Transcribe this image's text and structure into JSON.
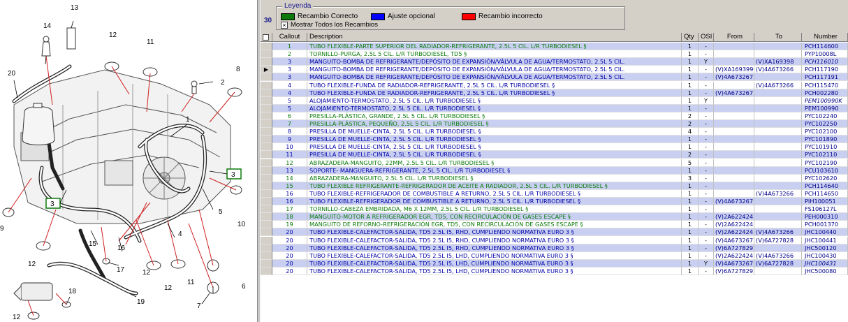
{
  "legend": {
    "title": "Leyenda",
    "items": [
      {
        "label": "Recambio Correcto",
        "color": "#0b7a0b"
      },
      {
        "label": "Ajuste opcional",
        "color": "#0000ff"
      },
      {
        "label": "Recambio incorrecto",
        "color": "#ff0000"
      }
    ],
    "show_all_label": "Mostrar Todos los Recambios",
    "show_all_checked": true,
    "record_count": "30"
  },
  "columns": [
    "Callout",
    "Description",
    "Qty",
    "OSI",
    "From",
    "To",
    "Number"
  ],
  "rows": [
    {
      "callout": "1",
      "desc": "TUBO FLEXIBLE-PARTE SUPERIOR DEL RADIADOR-REFRIGERANTE, 2.5L 5 CIL. L/R TURBODIESEL §",
      "qty": "1",
      "osi": "-",
      "from": "",
      "to": "",
      "number": "PCH114600",
      "color": "green",
      "hl": true
    },
    {
      "callout": "2",
      "desc": "TORNILLO-PURGA, 2.5L 5 CIL. L/R TURBODIESEL, TD5 §",
      "qty": "1",
      "osi": "-",
      "from": "",
      "to": "",
      "number": "PYP10008L",
      "color": "green",
      "hl": false
    },
    {
      "callout": "3",
      "desc": "MANGUITO-BOMBA DE REFRIGERANTE/DEPÓSITO DE EXPANSIÓN/VÁLVULA DE AGUA/TERMOSTATO, 2.5L 5 CIL.",
      "qty": "1",
      "osi": "Y",
      "from": "",
      "to": "(V)XA169398",
      "number": "PCH116010",
      "color": "blue",
      "hl": true,
      "italic_num": true
    },
    {
      "callout": "3",
      "desc": "MANGUITO-BOMBA DE REFRIGERANTE/DEPÓSITO DE EXPANSIÓN/VÁLVULA DE AGUA/TERMOSTATO, 2.5L 5 CIL.",
      "qty": "1",
      "osi": "-",
      "from": "(V)XA169399",
      "to": "(V)4A673266",
      "number": "PCH117190",
      "color": "blue",
      "hl": false,
      "current": true
    },
    {
      "callout": "3",
      "desc": "MANGUITO-BOMBA DE REFRIGERANTE/DEPÓSITO DE EXPANSIÓN/VÁLVULA DE AGUA/TERMOSTATO, 2.5L 5 CIL.",
      "qty": "1",
      "osi": "-",
      "from": "(V)4A673267",
      "to": "",
      "number": "PCH117191",
      "color": "blue",
      "hl": true
    },
    {
      "callout": "4",
      "desc": "TUBO FLEXIBLE-FUNDA DE RADIADOR-REFRIGERANTE, 2.5L 5 CIL. L/R TURBODIESEL §",
      "qty": "1",
      "osi": "-",
      "from": "",
      "to": "(V)4A673266",
      "number": "PCH115470",
      "color": "blue",
      "hl": false
    },
    {
      "callout": "4",
      "desc": "TUBO FLEXIBLE-FUNDA DE RADIADOR-REFRIGERANTE, 2.5L 5 CIL. L/R TURBODIESEL §",
      "qty": "1",
      "osi": "-",
      "from": "(V)4A673267",
      "to": "",
      "number": "PCH002280",
      "color": "blue",
      "hl": true
    },
    {
      "callout": "5",
      "desc": "ALOJAMIENTO-TERMOSTATO, 2.5L 5 CIL. L/R TURBODIESEL §",
      "qty": "1",
      "osi": "Y",
      "from": "",
      "to": "",
      "number": "PEM100990K",
      "color": "blue",
      "hl": false,
      "italic_num": true
    },
    {
      "callout": "5",
      "desc": "ALOJAMIENTO-TERMOSTATO, 2.5L 5 CIL. L/R TURBODIESEL §",
      "qty": "1",
      "osi": "-",
      "from": "",
      "to": "",
      "number": "PEM100990",
      "color": "blue",
      "hl": true
    },
    {
      "callout": "6",
      "desc": "PRESILLA-PLÁSTICA, GRANDE, 2.5L 5 CIL. L/R TURBODIESEL §",
      "qty": "2",
      "osi": "-",
      "from": "",
      "to": "",
      "number": "PYC102240",
      "color": "green",
      "hl": false
    },
    {
      "callout": "7",
      "desc": "PRESILLA-PLÁSTICA, PEQUEÑO, 2.5L 5 CIL. L/R TURBODIESEL §",
      "qty": "2",
      "osi": "-",
      "from": "",
      "to": "",
      "number": "PYC102250",
      "color": "green",
      "hl": true
    },
    {
      "callout": "8",
      "desc": "PRESILLA DE MUELLE-CINTA, 2.5L 5 CIL. L/R TURBODIESEL §",
      "qty": "4",
      "osi": "-",
      "from": "",
      "to": "",
      "number": "PYC102100",
      "color": "blue",
      "hl": false
    },
    {
      "callout": "9",
      "desc": "PRESILLA DE MUELLE-CINTA, 2.5L 5 CIL. L/R TURBODIESEL §",
      "qty": "1",
      "osi": "-",
      "from": "",
      "to": "",
      "number": "PYC101890",
      "color": "blue",
      "hl": true
    },
    {
      "callout": "10",
      "desc": "PRESILLA DE MUELLE-CINTA, 2.5L 5 CIL. L/R TURBODIESEL §",
      "qty": "1",
      "osi": "-",
      "from": "",
      "to": "",
      "number": "PYC101910",
      "color": "blue",
      "hl": false
    },
    {
      "callout": "11",
      "desc": "PRESILLA DE MUELLE-CINTA, 2.5L 5 CIL. L/R TURBODIESEL §",
      "qty": "2",
      "osi": "-",
      "from": "",
      "to": "",
      "number": "PYC102110",
      "color": "blue",
      "hl": true
    },
    {
      "callout": "12",
      "desc": "ABRAZADERA-MANGUITO, 22MM, 2.5L 5 CIL. L/R TURBODIESEL §",
      "qty": "5",
      "osi": "-",
      "from": "",
      "to": "",
      "number": "PYC102190",
      "color": "green",
      "hl": false
    },
    {
      "callout": "13",
      "desc": "SOPORTE- MANGUERA-REFRIGERANTE, 2.5L 5 CIL. L/R TURBODIESEL §",
      "qty": "1",
      "osi": "-",
      "from": "",
      "to": "",
      "number": "PCU103610",
      "color": "blue",
      "hl": true
    },
    {
      "callout": "14",
      "desc": "ABRAZADERA-MANGUITO, 2.5L 5 CIL. L/R TURBODIESEL §",
      "qty": "3",
      "osi": "-",
      "from": "",
      "to": "",
      "number": "PYC102620",
      "color": "green",
      "hl": false
    },
    {
      "callout": "15",
      "desc": "TUBO FLEXIBLE REFRIGERANTE-REFRIGERADOR DE ACEITE A RADIADOR, 2.5L 5 CIL. L/R TURBODIESEL §",
      "qty": "1",
      "osi": "-",
      "from": "",
      "to": "",
      "number": "PCH114640",
      "color": "green",
      "hl": true
    },
    {
      "callout": "16",
      "desc": "TUBO FLEXIBLE-REFRIGERADOR DE COMBUSTIBLE A RETURNO, 2.5L 5 CIL. L/R TURBODIESEL §",
      "qty": "1",
      "osi": "-",
      "from": "",
      "to": "(V)4A673266",
      "number": "PCH114650",
      "color": "blue",
      "hl": false
    },
    {
      "callout": "16",
      "desc": "TUBO FLEXIBLE-REFRIGERADOR DE COMBUSTIBLE A RETURNO, 2.5L 5 CIL. L/R TURBODIESEL §",
      "qty": "1",
      "osi": "-",
      "from": "(V)4A673267",
      "to": "",
      "number": "PIH100051",
      "color": "blue",
      "hl": true
    },
    {
      "callout": "17",
      "desc": "TORNILLO-CABEZA EMBRIDADA, M6 X 12MM, 2.5L 5 CIL. L/R TURBODIESEL §",
      "qty": "1",
      "osi": "-",
      "from": "",
      "to": "",
      "number": "FS106127L",
      "color": "green",
      "hl": false
    },
    {
      "callout": "18",
      "desc": "MANGUITO-MOTOR A REFRIGERADOR EGR, TD5, CON RECIRCULACIÓN DE GASES ESCAPE §",
      "qty": "1",
      "osi": "-",
      "from": "(V)2A622424",
      "to": "",
      "number": "PEH000310",
      "color": "green",
      "hl": true
    },
    {
      "callout": "19",
      "desc": "MANGUITO DE REFORNO-REFRIGERACIÓN EGR, TD5, CON RECIRCULACIÓN DE GASES ESCAPE §",
      "qty": "1",
      "osi": "-",
      "from": "(V)2A622424",
      "to": "",
      "number": "PCH001370",
      "color": "green",
      "hl": false
    },
    {
      "callout": "20",
      "desc": "TUBO FLEXIBLE-CALEFACTOR-SALIDA, TD5 2.5L I5, RHD, CUMPLIENDO NORMATIVA EURO 3 §",
      "qty": "1",
      "osi": "-",
      "from": "(V)2A622424",
      "to": "(V)4A673266",
      "number": "JHC100440",
      "color": "blue",
      "hl": true
    },
    {
      "callout": "20",
      "desc": "TUBO FLEXIBLE-CALEFACTOR-SALIDA, TD5 2.5L I5, RHD, CUMPLIENDO NORMATIVA EURO 3 §",
      "qty": "1",
      "osi": "-",
      "from": "(V)4A673267",
      "to": "(V)6A727828",
      "number": "JHC100441",
      "color": "blue",
      "hl": false
    },
    {
      "callout": "20",
      "desc": "TUBO FLEXIBLE-CALEFACTOR-SALIDA, TD5 2.5L I5, RHD, CUMPLIENDO NORMATIVA EURO 3 §",
      "qty": "1",
      "osi": "-",
      "from": "(V)6A727829",
      "to": "",
      "number": "JHC500120",
      "color": "blue",
      "hl": true
    },
    {
      "callout": "20",
      "desc": "TUBO FLEXIBLE-CALEFACTOR-SALIDA, TD5 2.5L I5, LHD, CUMPLIENDO NORMATIVA EURO 3 §",
      "qty": "1",
      "osi": "-",
      "from": "(V)2A622424",
      "to": "(V)4A673266",
      "number": "JHC100430",
      "color": "blue",
      "hl": false
    },
    {
      "callout": "20",
      "desc": "TUBO FLEXIBLE-CALEFACTOR-SALIDA, TD5 2.5L I5, LHD, CUMPLIENDO NORMATIVA EURO 3 §",
      "qty": "1",
      "osi": "Y",
      "from": "(V)4A673267",
      "to": "(V)6A727828",
      "number": "JHC100431",
      "color": "blue",
      "hl": true,
      "italic_num": true
    },
    {
      "callout": "20",
      "desc": "TUBO FLEXIBLE-CALEFACTOR-SALIDA, TD5 2.5L I5, LHD, CUMPLIENDO NORMATIVA EURO 3 §",
      "qty": "1",
      "osi": "-",
      "from": "(V)6A727829",
      "to": "",
      "number": "JHC500080",
      "color": "blue",
      "hl": false
    }
  ],
  "diagram": {
    "callouts": [
      "1",
      "2",
      "3",
      "3",
      "4",
      "5",
      "6",
      "7",
      "8",
      "9",
      "10",
      "11",
      "11",
      "12",
      "12",
      "12",
      "13",
      "14",
      "15",
      "16",
      "17",
      "18",
      "19",
      "20",
      "12",
      "10",
      "9"
    ]
  }
}
